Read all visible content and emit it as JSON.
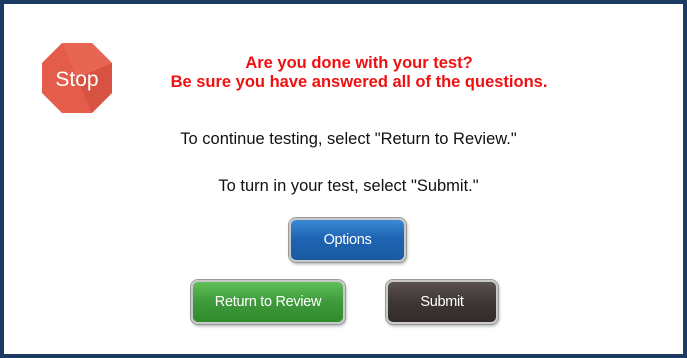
{
  "dialog": {
    "stop_icon_label": "Stop",
    "heading_line1": "Are you done with your test?",
    "heading_line2": "Be sure you have answered all of the questions.",
    "instruction_review": "To continue testing, select \"Return to Review.\"",
    "instruction_submit": "To turn in your test, select \"Submit.\""
  },
  "buttons": {
    "options_label": "Options",
    "return_label": "Return to Review",
    "submit_label": "Submit"
  },
  "colors": {
    "frame": "#1d3a63",
    "heading": "#ee1111",
    "stop_sign": "#e05a48",
    "options_button": "#1f64b3",
    "return_button": "#3e9a3a",
    "submit_button": "#3e3735"
  }
}
